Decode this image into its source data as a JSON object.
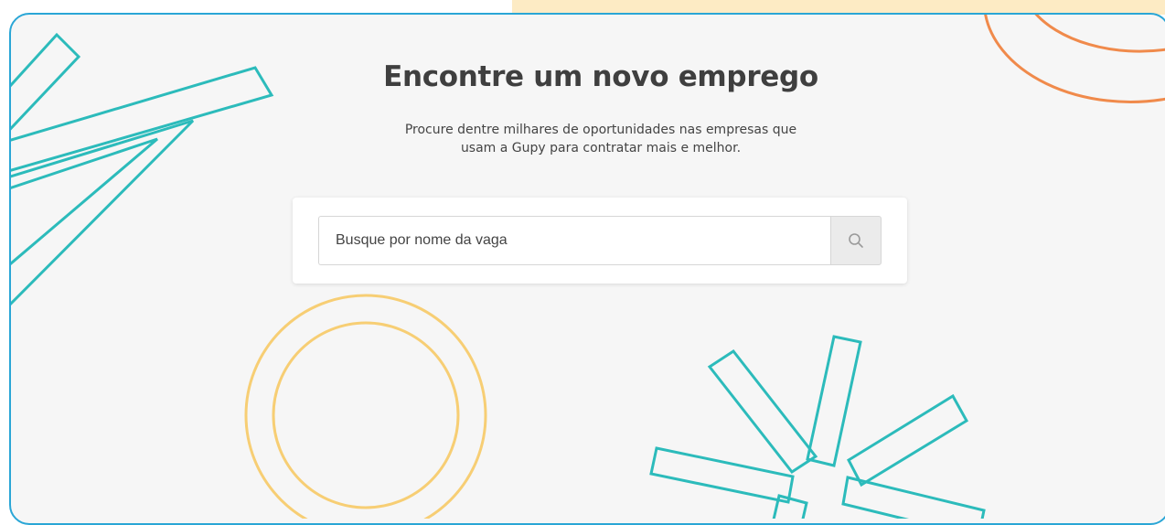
{
  "hero": {
    "title": "Encontre um novo emprego",
    "subtitle_line1": "Procure dentre milhares de oportunidades nas empresas que",
    "subtitle_line2": "usam a Gupy para contratar mais e melhor."
  },
  "search": {
    "placeholder": "Busque por nome da vaga",
    "value": "",
    "button_icon": "search-icon"
  },
  "colors": {
    "frame_border": "#2aa6d6",
    "background": "#f6f6f6",
    "teal_decor": "#2cbbbb",
    "orange_decor": "#f08a4b",
    "yellow_decor": "#f7ce74",
    "top_strip": "#fdebc4"
  }
}
